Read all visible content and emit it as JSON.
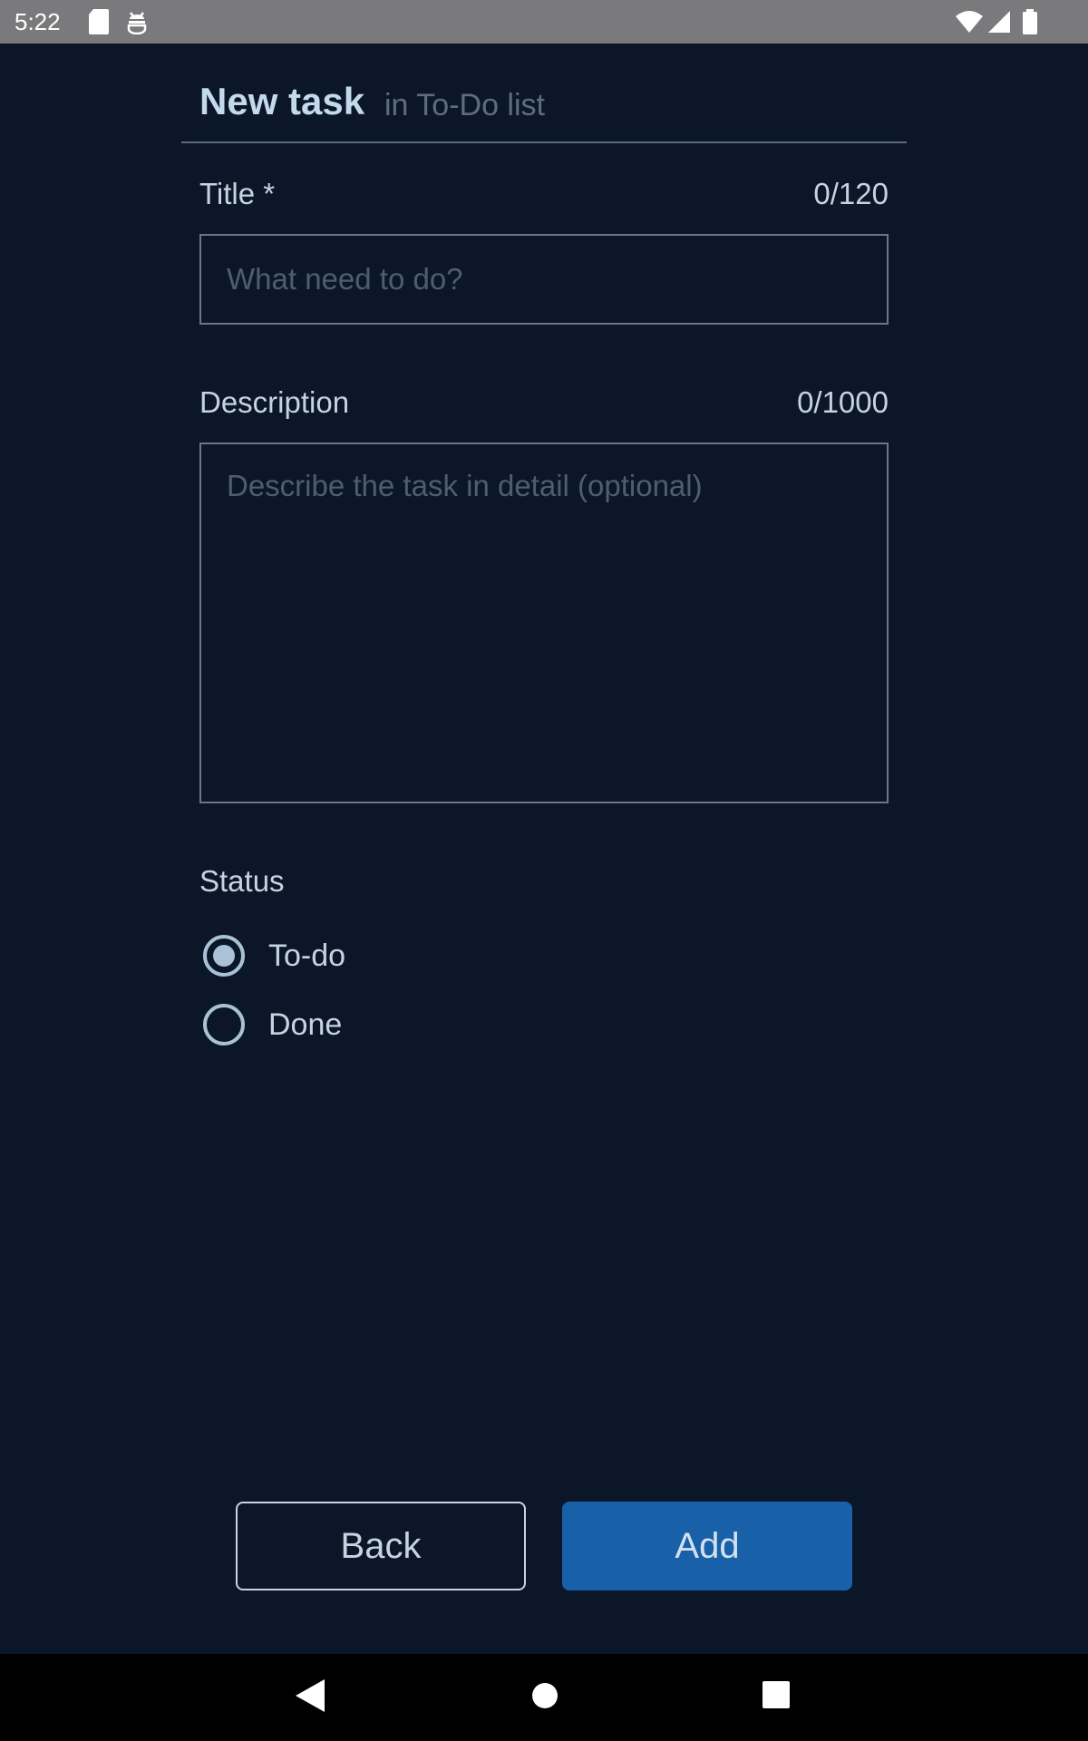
{
  "status_bar": {
    "time": "5:22",
    "icons_left": [
      "sd-card-icon",
      "android-debug-icon"
    ],
    "icons_right": [
      "wifi-icon",
      "cell-signal-icon",
      "battery-icon"
    ]
  },
  "header": {
    "title": "New task",
    "subtitle": "in To-Do list"
  },
  "form": {
    "title_field": {
      "label": "Title *",
      "counter": "0/120",
      "value": "",
      "placeholder": "What need to do?"
    },
    "description_field": {
      "label": "Description",
      "counter": "0/1000",
      "value": "",
      "placeholder": "Describe the task in detail (optional)"
    },
    "status": {
      "label": "Status",
      "options": [
        {
          "label": "To-do",
          "selected": true
        },
        {
          "label": "Done",
          "selected": false
        }
      ]
    }
  },
  "actions": {
    "back_label": "Back",
    "add_label": "Add"
  },
  "navigation_bar": {
    "buttons": [
      "back-triangle-icon",
      "home-circle-icon",
      "recents-square-icon"
    ]
  },
  "colors": {
    "background": "#0b1729",
    "accent": "#1860a8",
    "text": "#c6d3e0",
    "placeholder": "#4f5d70"
  }
}
